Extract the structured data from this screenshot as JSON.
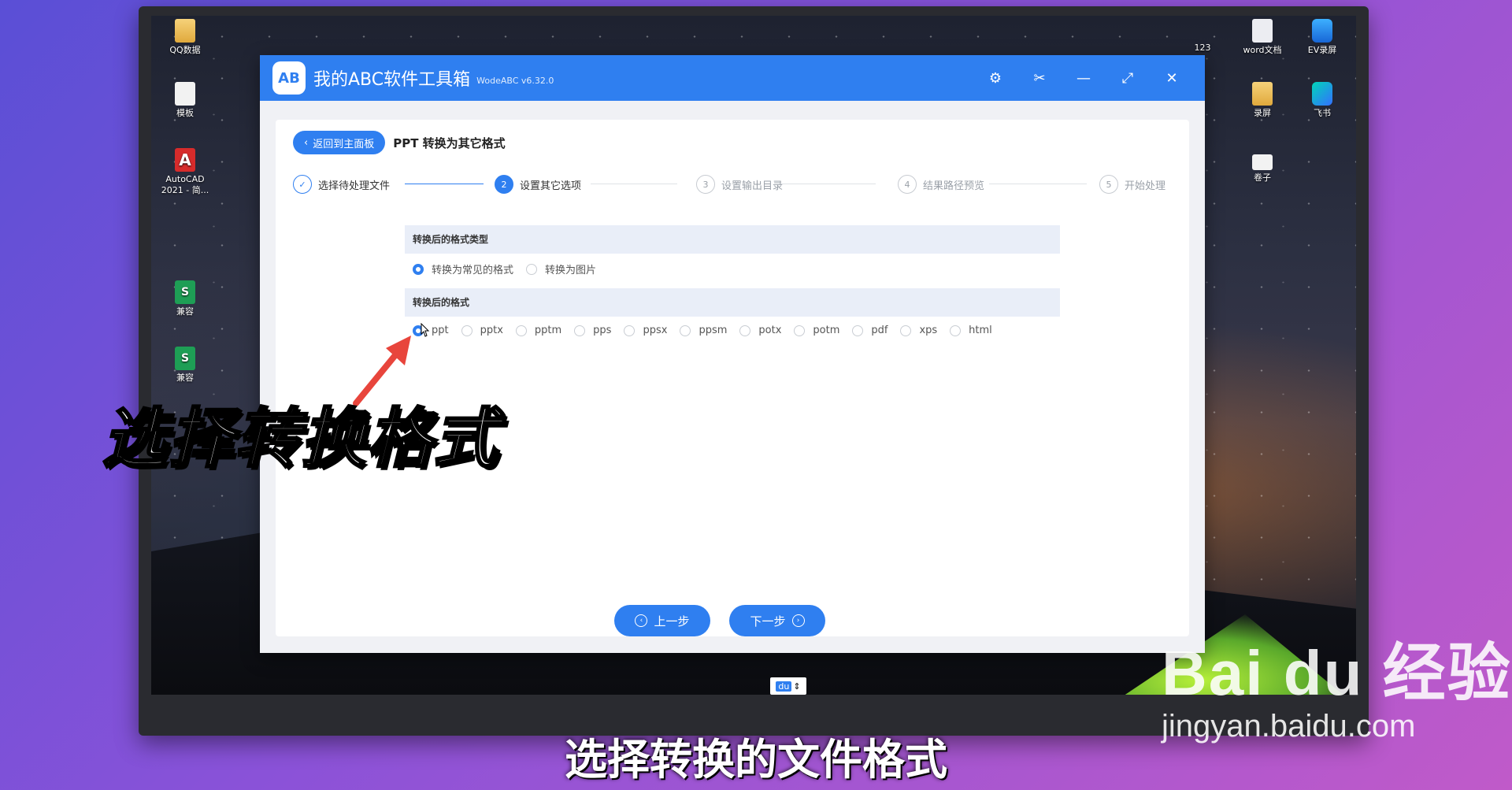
{
  "desktop": {
    "icons_left": [
      {
        "label": "QQ数据",
        "type": "folder"
      },
      {
        "label": "模板",
        "type": "file"
      },
      {
        "label": "AutoCAD 2021 - 简...",
        "type": "autocad"
      },
      {
        "label": "兼容",
        "type": "green"
      },
      {
        "label": "兼容",
        "type": "green"
      }
    ],
    "icons_right": [
      {
        "label": "123",
        "type": "plain"
      },
      {
        "label": "word文档",
        "type": "wordfile"
      },
      {
        "label": "EV录屏",
        "type": "ev"
      },
      {
        "label": "录屏",
        "type": "folder"
      },
      {
        "label": "飞书",
        "type": "feishu"
      },
      {
        "label": "卷子",
        "type": "file"
      }
    ]
  },
  "app": {
    "title": "我的ABC软件工具箱",
    "version": "WodeABC v6.32.0",
    "logo_text": "AB",
    "window_buttons": {
      "settings": "⚙",
      "scissors": "✂",
      "minimize": "—",
      "maximize": "⤢",
      "close": "✕"
    }
  },
  "header": {
    "back_label": "返回到主面板",
    "page_title": "PPT 转换为其它格式"
  },
  "steps": [
    {
      "num": "✓",
      "label": "选择待处理文件",
      "state": "done"
    },
    {
      "num": "2",
      "label": "设置其它选项",
      "state": "active"
    },
    {
      "num": "3",
      "label": "设置输出目录",
      "state": "pending"
    },
    {
      "num": "4",
      "label": "结果路径预览",
      "state": "pending"
    },
    {
      "num": "5",
      "label": "开始处理",
      "state": "pending"
    }
  ],
  "section1": {
    "title": "转换后的格式类型",
    "options": [
      {
        "label": "转换为常见的格式",
        "selected": true
      },
      {
        "label": "转换为图片",
        "selected": false
      }
    ]
  },
  "section2": {
    "title": "转换后的格式",
    "options": [
      {
        "label": "ppt",
        "selected": true
      },
      {
        "label": "pptx",
        "selected": false
      },
      {
        "label": "pptm",
        "selected": false
      },
      {
        "label": "pps",
        "selected": false
      },
      {
        "label": "ppsx",
        "selected": false
      },
      {
        "label": "ppsm",
        "selected": false
      },
      {
        "label": "potx",
        "selected": false
      },
      {
        "label": "potm",
        "selected": false
      },
      {
        "label": "pdf",
        "selected": false
      },
      {
        "label": "xps",
        "selected": false
      },
      {
        "label": "html",
        "selected": false
      }
    ]
  },
  "footer": {
    "prev_label": "上一步",
    "next_label": "下一步"
  },
  "ime": {
    "label": "du"
  },
  "overlay": {
    "caption": "选择转换格式",
    "subtitle": "选择转换的文件格式"
  },
  "watermark": {
    "brand": "Bai du 经验",
    "url": "jingyan.baidu.com"
  },
  "colors": {
    "accent": "#2f7ff0",
    "section_bg": "#e9eef8",
    "arrow": "#e8453c"
  }
}
